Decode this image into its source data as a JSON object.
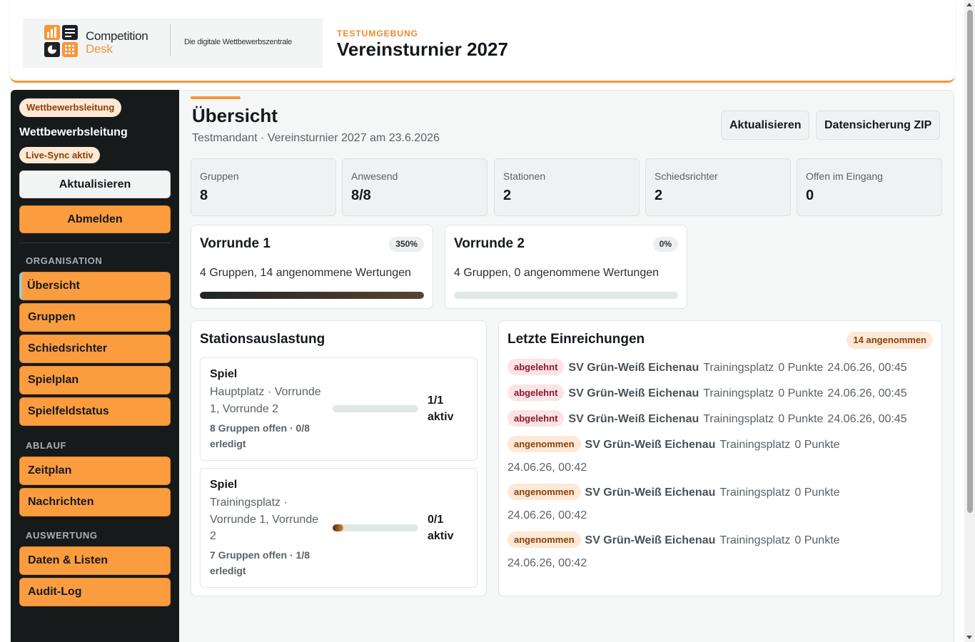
{
  "brand": {
    "name_line1": "Competition",
    "name_line2": "Desk",
    "tagline": "Die digitale Wettbewerbszentrale"
  },
  "header": {
    "environment": "TESTUMGEBUNG",
    "title": "Vereinsturnier 2027"
  },
  "sidebar": {
    "role_badge": "Wettbewerbsleitung",
    "role_name": "Wettbewerbsleitung",
    "sync_badge": "Live-Sync aktiv",
    "refresh_label": "Aktualisieren",
    "logout_label": "Abmelden",
    "sections": [
      {
        "label": "ORGANISATION",
        "items": [
          "Übersicht",
          "Gruppen",
          "Schiedsrichter",
          "Spielplan",
          "Spielfeldstatus"
        ]
      },
      {
        "label": "ABLAUF",
        "items": [
          "Zeitplan",
          "Nachrichten"
        ]
      },
      {
        "label": "AUSWERTUNG",
        "items": [
          "Daten & Listen",
          "Audit-Log"
        ]
      }
    ],
    "active_item": "Übersicht"
  },
  "page": {
    "title": "Übersicht",
    "subtitle": "Testmandant · Vereinsturnier 2027 am 23.6.2026",
    "refresh_label": "Aktualisieren",
    "backup_label": "Datensicherung ZIP"
  },
  "stats": [
    {
      "label": "Gruppen",
      "value": "8"
    },
    {
      "label": "Anwesend",
      "value": "8/8"
    },
    {
      "label": "Stationen",
      "value": "2"
    },
    {
      "label": "Schiedsrichter",
      "value": "2"
    },
    {
      "label": "Offen im Eingang",
      "value": "0"
    }
  ],
  "rounds": [
    {
      "title": "Vorrunde 1",
      "percent_label": "350%",
      "description": "4 Gruppen, 14 angenommene Wertungen",
      "progress": 1.0
    },
    {
      "title": "Vorrunde 2",
      "percent_label": "0%",
      "description": "4 Gruppen, 0 angenommene Wertungen",
      "progress": 0.0
    }
  ],
  "stations": {
    "title": "Stationsauslastung",
    "items": [
      {
        "name": "Spiel",
        "location": "Hauptplatz · Vorrunde 1, Vorrunde 2",
        "open": "8 Gruppen offen · 0/8 erledigt",
        "count_line1": "1/1",
        "count_line2": "aktiv",
        "progress": 0.0
      },
      {
        "name": "Spiel",
        "location": "Trainingsplatz · Vorrunde 1, Vorrunde 2",
        "open": "7 Gruppen offen · 1/8 erledigt",
        "count_line1": "0/1",
        "count_line2": "aktiv",
        "progress": 0.125
      }
    ]
  },
  "submissions": {
    "title": "Letzte Einreichungen",
    "count_badge": "14 angenommen",
    "items": [
      {
        "status": "abgelehnt",
        "team": "SV Grün-Weiß Eichenau",
        "place": "Trainingsplatz",
        "points": "0 Punkte",
        "time": "24.06.26, 00:45"
      },
      {
        "status": "abgelehnt",
        "team": "SV Grün-Weiß Eichenau",
        "place": "Trainingsplatz",
        "points": "0 Punkte",
        "time": "24.06.26, 00:45"
      },
      {
        "status": "abgelehnt",
        "team": "SV Grün-Weiß Eichenau",
        "place": "Trainingsplatz",
        "points": "0 Punkte",
        "time": "24.06.26, 00:45"
      },
      {
        "status": "angenommen",
        "team": "SV Grün-Weiß Eichenau",
        "place": "Trainingsplatz",
        "points": "0 Punkte",
        "time": "24.06.26, 00:42"
      },
      {
        "status": "angenommen",
        "team": "SV Grün-Weiß Eichenau",
        "place": "Trainingsplatz",
        "points": "0 Punkte",
        "time": "24.06.26, 00:42"
      },
      {
        "status": "angenommen",
        "team": "SV Grün-Weiß Eichenau",
        "place": "Trainingsplatz",
        "points": "0 Punkte",
        "time": "24.06.26, 00:42"
      }
    ]
  },
  "colors": {
    "accent": "#f7963a",
    "sidebar_bg": "#161a1b",
    "nav_button": "#fb9d3f"
  }
}
